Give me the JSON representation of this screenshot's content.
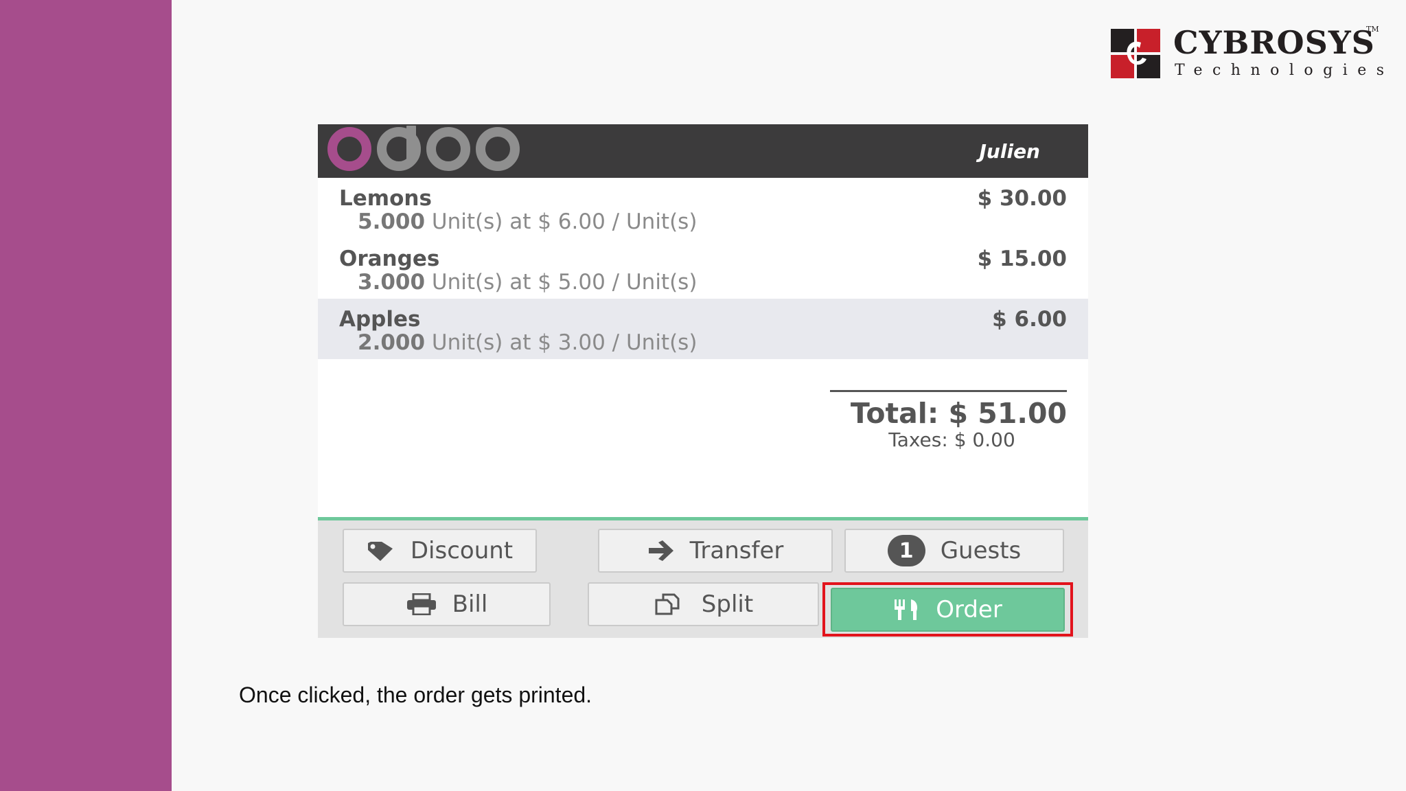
{
  "slide": {
    "caption": "Once clicked, the order gets printed."
  },
  "brand": {
    "name": "CYBROSYS",
    "tm": "TM",
    "tagline": "Technologies",
    "colors": {
      "red": "#c8202a",
      "dark": "#231f20"
    }
  },
  "pos": {
    "logo_text": "odoo",
    "user": "Julien",
    "lines": [
      {
        "name": "Lemons",
        "price": "$ 30.00",
        "qty": "5.000",
        "unit_text": "Unit(s) at $ 6.00 / Unit(s)",
        "selected": false
      },
      {
        "name": "Oranges",
        "price": "$ 15.00",
        "qty": "3.000",
        "unit_text": "Unit(s) at $ 5.00 / Unit(s)",
        "selected": false
      },
      {
        "name": "Apples",
        "price": "$ 6.00",
        "qty": "2.000",
        "unit_text": "Unit(s) at $ 3.00 / Unit(s)",
        "selected": true
      }
    ],
    "summary": {
      "total": "Total: $ 51.00",
      "taxes": "Taxes: $ 0.00"
    },
    "buttons": {
      "discount": {
        "label": "Discount",
        "icon": "tag-icon"
      },
      "transfer": {
        "label": "Transfer",
        "icon": "arrow-right-icon"
      },
      "guests": {
        "label": "Guests",
        "count": "1"
      },
      "bill": {
        "label": "Bill",
        "icon": "printer-icon"
      },
      "split": {
        "label": "Split",
        "icon": "copy-icon"
      },
      "order": {
        "label": "Order",
        "icon": "cutlery-icon"
      }
    },
    "colors": {
      "accent": "#6ec89b",
      "highlight": "#e2131c",
      "header": "#3c3b3c",
      "odoo_purple": "#a64d8c"
    }
  }
}
